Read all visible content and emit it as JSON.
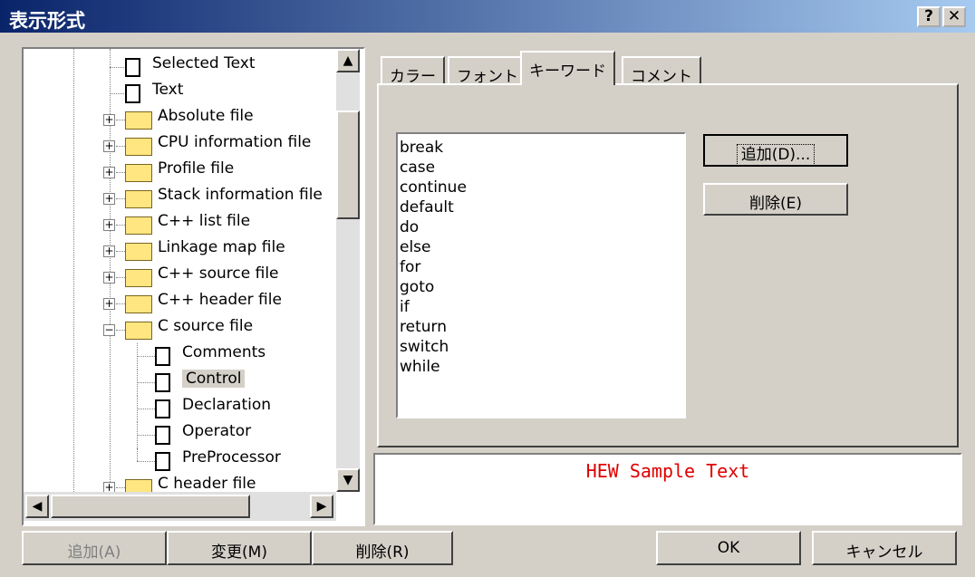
{
  "window": {
    "title": "表示形式",
    "help_label": "?",
    "close_label": "✕"
  },
  "tree": {
    "items": [
      {
        "label": "Selected Text",
        "type": "doc"
      },
      {
        "label": "Text",
        "type": "doc"
      },
      {
        "label": "Absolute file",
        "type": "folder"
      },
      {
        "label": "CPU information file",
        "type": "folder"
      },
      {
        "label": "Profile file",
        "type": "folder"
      },
      {
        "label": "Stack information file",
        "type": "folder"
      },
      {
        "label": "C++ list file",
        "type": "folder"
      },
      {
        "label": "Linkage map file",
        "type": "folder"
      },
      {
        "label": "C++ source file",
        "type": "folder"
      },
      {
        "label": "C++ header file",
        "type": "folder"
      },
      {
        "label": "C source file",
        "type": "folder",
        "expanded": true
      },
      {
        "label": "Comments",
        "type": "doc"
      },
      {
        "label": "Control",
        "type": "doc",
        "selected": true
      },
      {
        "label": "Declaration",
        "type": "doc"
      },
      {
        "label": "Operator",
        "type": "doc"
      },
      {
        "label": "PreProcessor",
        "type": "doc"
      },
      {
        "label": "C header file",
        "type": "folder"
      }
    ],
    "expand_sign": "+",
    "collapse_sign": "−"
  },
  "tabs": [
    {
      "label": "カラー"
    },
    {
      "label": "フォント"
    },
    {
      "label": "キーワード",
      "active": true
    },
    {
      "label": "コメント"
    }
  ],
  "keywords": [
    "break",
    "case",
    "continue",
    "default",
    "do",
    "else",
    "for",
    "goto",
    "if",
    "return",
    "switch",
    "while"
  ],
  "keyword_buttons": {
    "add": "追加(D)...",
    "remove": "削除(E)"
  },
  "sample_text": "HEW Sample Text",
  "bottom_buttons": {
    "add": "追加(A)",
    "change": "変更(M)",
    "remove": "削除(R)",
    "ok": "OK",
    "cancel": "キャンセル"
  },
  "colors": {
    "sample_text": "#e00000",
    "selection": "#d4d0c8"
  }
}
